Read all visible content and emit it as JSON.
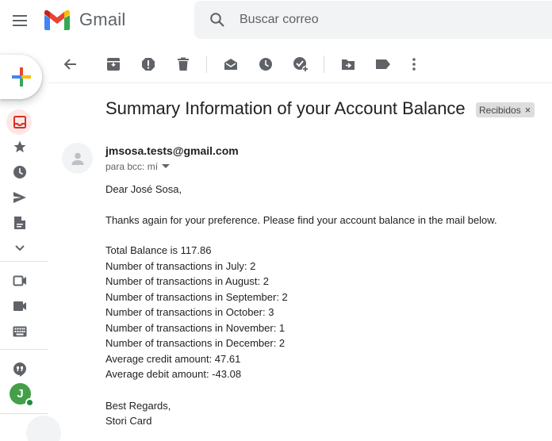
{
  "header": {
    "app_name": "Gmail",
    "search_placeholder": "Buscar correo"
  },
  "message": {
    "subject": "Summary Information of your Account Balance",
    "label": "Recibidos",
    "sender_email": "jmsosa.tests@gmail.com",
    "recipient_line": "para bcc: mí",
    "greeting": "Dear José Sosa,",
    "intro": "Thanks again for your preference. Please find your account balance in the mail below.",
    "lines": [
      "Total Balance is 117.86",
      "Number of transactions in July: 2",
      "Number of transactions in August: 2",
      "Number of transactions in September: 2",
      "Number of transactions in October: 3",
      "Number of transactions in November: 1",
      "Number of transactions in December: 2",
      "Average credit amount: 47.61",
      "Average debit amount: -43.08"
    ],
    "closing": "Best Regards,",
    "signature": "Stori Card"
  },
  "account": {
    "avatar_initial": "J"
  },
  "colors": {
    "gmail_red": "#ea4335",
    "gmail_blue": "#4285f4",
    "gmail_green": "#34a853",
    "gmail_yellow": "#fbbc04",
    "icon_gray": "#5f6368",
    "inbox_highlight": "#fce8e6",
    "avatar_green": "#43a047"
  },
  "icons": {
    "rail": [
      "compose-plus-icon",
      "inbox-icon",
      "star-icon",
      "clock-icon",
      "send-icon",
      "draft-icon",
      "chevron-down-icon",
      "meet-new-icon",
      "videocam-icon",
      "keyboard-icon",
      "hangouts-icon"
    ],
    "toolbar": [
      "back-arrow-icon",
      "archive-icon",
      "report-spam-icon",
      "delete-icon",
      "mark-unread-icon",
      "snooze-icon",
      "add-task-icon",
      "move-to-icon",
      "label-icon",
      "more-vert-icon"
    ]
  }
}
